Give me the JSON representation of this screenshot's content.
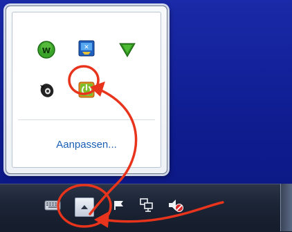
{
  "popup": {
    "customize_label": "Aanpassen...",
    "icons": [
      {
        "name": "w-app-icon",
        "letter": "w"
      },
      {
        "name": "remote-connection-icon"
      },
      {
        "name": "green-arrow-down-icon"
      },
      {
        "name": "speaker-icon"
      },
      {
        "name": "power-icon"
      }
    ]
  },
  "taskbar": {
    "tray_icons": [
      "keyboard-icon",
      "flag-icon",
      "network-icon",
      "volume-muted-icon"
    ]
  },
  "colors": {
    "annotation": "#e8341c",
    "link": "#1a5fb4",
    "desktop": "#0d1f9e"
  }
}
